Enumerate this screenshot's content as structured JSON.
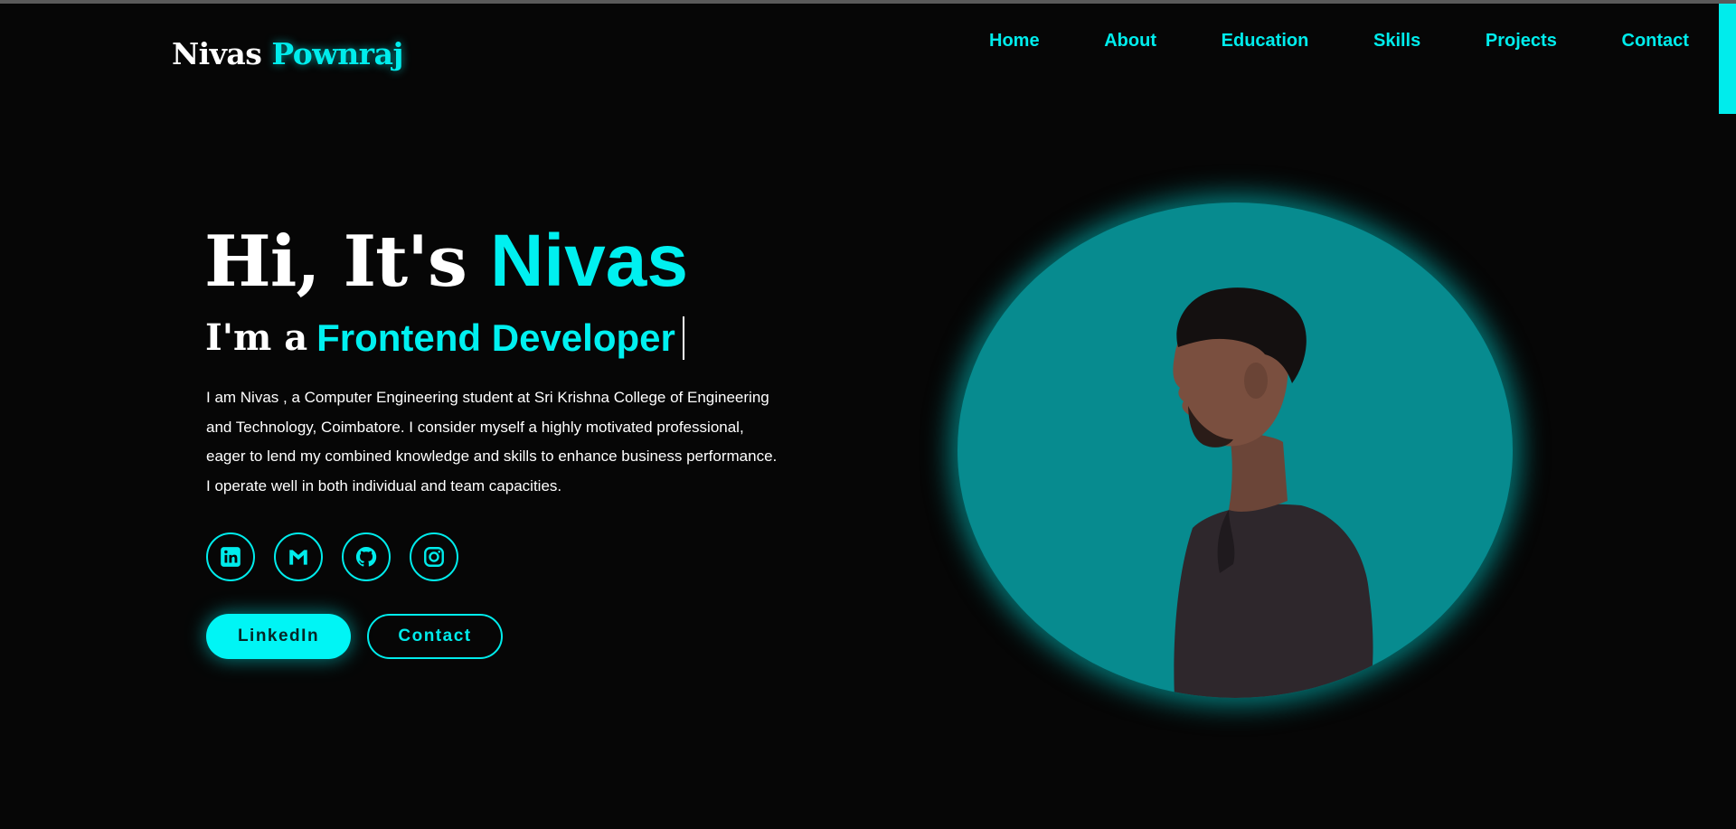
{
  "header": {
    "logo_first": "Nivas",
    "logo_last": "Pownraj"
  },
  "nav": {
    "items": [
      "Home",
      "About",
      "Education",
      "Skills",
      "Projects",
      "Contact"
    ]
  },
  "hero": {
    "greeting": "Hi, It's",
    "name": "Nivas",
    "role_prefix": "I'm a",
    "role": "Frontend Developer",
    "about": "I am Nivas , a Computer Engineering student at Sri Krishna College of Engineering and Technology, Coimbatore. I consider myself a highly motivated professional, eager to lend my combined knowledge and skills to enhance business performance. I operate well in both individual and team capacities."
  },
  "socials": {
    "icons": [
      "linkedin-icon",
      "gmail-icon",
      "github-icon",
      "instagram-icon"
    ]
  },
  "buttons": {
    "primary": "LinkedIn",
    "secondary": "Contact"
  },
  "colors": {
    "accent": "#00ecec",
    "background": "#060606",
    "portrait_bg": "#078b8f"
  }
}
